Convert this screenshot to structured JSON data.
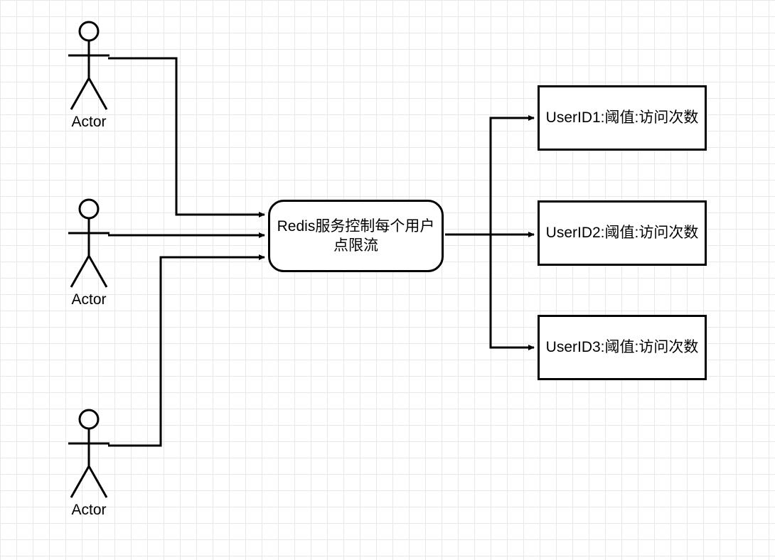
{
  "actors": [
    {
      "label": "Actor"
    },
    {
      "label": "Actor"
    },
    {
      "label": "Actor"
    }
  ],
  "redis": {
    "label": "Redis服务控制每个用户点限流"
  },
  "users": [
    {
      "label": "UserID1:阈值:访问次数"
    },
    {
      "label": "UserID2:阈值:访问次数"
    },
    {
      "label": "UserID3:阈值:访问次数"
    }
  ]
}
